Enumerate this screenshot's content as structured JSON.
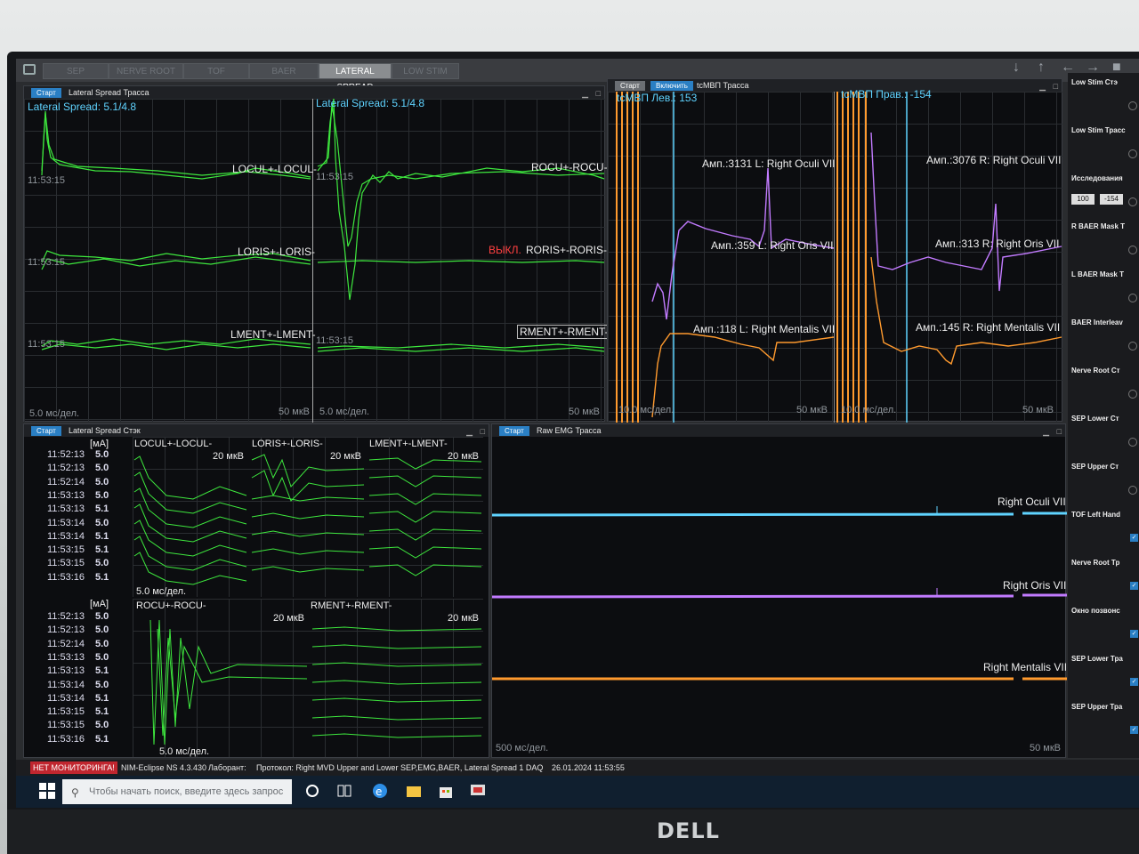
{
  "toolbar": {
    "tabs": [
      "SEP",
      "NERVE ROOT",
      "TOF",
      "BAER",
      "LATERAL SPREAD",
      "LOW STIM"
    ],
    "active_tab": "LATERAL SPREAD"
  },
  "lateral_trace": {
    "start": "Старт",
    "title": "Lateral Spread Трасса",
    "left": {
      "value": "Lateral Spread: 5.1/4.8",
      "ch1": "LOCUL+-LOCUL-",
      "ch2": "LORIS+-LORIS-",
      "ch3": "LMENT+-LMENT-",
      "time": "11:53:15",
      "scale": "5.0 мс/дел.",
      "amp": "50 мкВ"
    },
    "right": {
      "value": "Lateral Spread: 5.1/4.8",
      "ch1": "ROCU+-ROCU-",
      "ch2": "RORIS+-RORIS-",
      "off": "ВЫКЛ.",
      "ch3": "RMENT+-RMENT-",
      "time": "11:53:15",
      "scale": "5.0 мс/дел.",
      "amp": "50 мкВ"
    }
  },
  "tcmep_trace": {
    "start": "Старт",
    "enable": "Включить",
    "title": "tcМВП Трасса",
    "left_label": "tcМВП Лев.: 153",
    "right_label": "tcМВП Прав.: -154",
    "amp_l1": "Амп.:3131 L: Right Oculi VII",
    "amp_l2": "Амп.:359 L: Right Oris VII",
    "amp_l3": "Амп.:118 L: Right Mentalis VII",
    "amp_r1": "Амп.:3076 R: Right Oculi VII",
    "amp_r2": "Амп.:313 R: Right Oris VII",
    "amp_r3": "Амп.:145 R: Right Mentalis VII",
    "scale_l": "10.0 мс/дел.",
    "amp_lv": "50 мкВ",
    "scale_r": "10.0 мс/дел.",
    "amp_rv": "50 мкВ"
  },
  "stack": {
    "start": "Старт",
    "title": "Lateral Spread Стэк",
    "unit": "[мА]",
    "times": [
      "11:52:13",
      "11:52:13",
      "11:52:14",
      "11:53:13",
      "11:53:13",
      "11:53:14",
      "11:53:14",
      "11:53:15",
      "11:53:15",
      "11:53:16"
    ],
    "values": [
      "5.0",
      "5.0",
      "5.0",
      "5.0",
      "5.1",
      "5.0",
      "5.1",
      "5.1",
      "5.0",
      "5.1"
    ],
    "top_ch": [
      "LOCUL+-LOCUL-",
      "LORIS+-LORIS-",
      "LMENT+-LMENT-"
    ],
    "bottom_ch": [
      "ROCU+-ROCU-",
      "RMENT+-RMENT-"
    ],
    "amp": "20 мкВ",
    "scale": "5.0 мс/дел."
  },
  "raw_emg": {
    "start": "Старт",
    "title": "Raw EMG Трасса",
    "ch1": "Right Oculi VII",
    "ch2": "Right Oris VII",
    "ch3": "Right Mentalis VII",
    "scale": "500 мс/дел.",
    "amp": "50 мкВ"
  },
  "sidebar": {
    "items": [
      "Low Stim Стэ",
      "Low Stim Трасс",
      "Исследования",
      "R BAER Mask T",
      "L BAER Mask T",
      "BAER Interleav",
      "Nerve Root Ст",
      "SEP Lower Ст",
      "SEP Upper Ст",
      "TOF Left Hand",
      "Nerve Root Тр",
      "Окно позвонс",
      "SEP Lower Тра",
      "SEP Upper Тра"
    ],
    "study_value": "100",
    "study_value2": "-154"
  },
  "status": {
    "monitoring": "НЕТ МОНИТОРИНГА!",
    "app": "NIM-Eclipse NS 4.3.430",
    "lab": "Лаборант:",
    "protocol": "Протокол: Right MVD Upper and Lower SEP,EMG,BAER, Lateral Spread 1 DAQ",
    "datetime": "26.01.2024 11:53:55"
  },
  "taskbar": {
    "search_placeholder": "Чтобы начать поиск, введите здесь запрос"
  },
  "monitor": {
    "brand": "DELL"
  },
  "colors": {
    "green": "#3ee83e",
    "purple": "#c27bff",
    "orange": "#ff9a2e",
    "cyan": "#5fd3ff"
  }
}
